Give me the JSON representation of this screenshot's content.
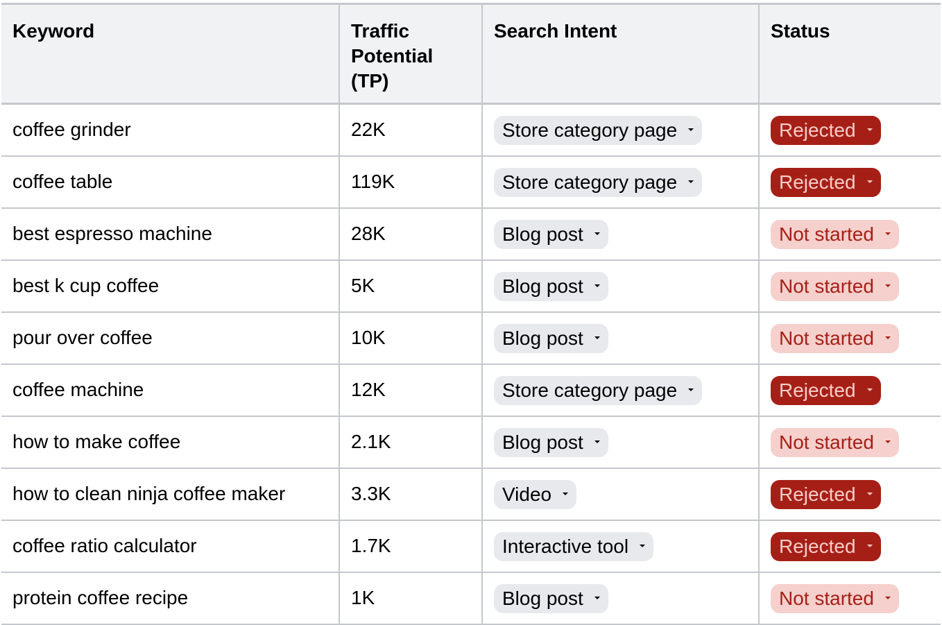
{
  "table": {
    "headers": {
      "keyword": "Keyword",
      "traffic_line1": "Traffic",
      "traffic_line2": "Potential",
      "traffic_line3": "(TP)",
      "intent": "Search Intent",
      "status": "Status"
    },
    "rows": [
      {
        "keyword": "coffee grinder",
        "tp": "22K",
        "intent": "Store category page",
        "status": "Rejected"
      },
      {
        "keyword": "coffee table",
        "tp": "119K",
        "intent": "Store category page",
        "status": "Rejected"
      },
      {
        "keyword": "best espresso machine",
        "tp": "28K",
        "intent": "Blog post",
        "status": "Not started"
      },
      {
        "keyword": "best k cup coffee",
        "tp": "5K",
        "intent": "Blog post",
        "status": "Not started"
      },
      {
        "keyword": "pour over coffee",
        "tp": "10K",
        "intent": "Blog post",
        "status": "Not started"
      },
      {
        "keyword": "coffee machine",
        "tp": "12K",
        "intent": "Store category page",
        "status": "Rejected"
      },
      {
        "keyword": "how to make coffee",
        "tp": "2.1K",
        "intent": "Blog post",
        "status": "Not started"
      },
      {
        "keyword": "how to clean ninja coffee maker",
        "tp": "3.3K",
        "intent": "Video",
        "status": "Rejected"
      },
      {
        "keyword": "coffee ratio calculator",
        "tp": "1.7K",
        "intent": "Interactive tool",
        "status": "Rejected"
      },
      {
        "keyword": "protein coffee recipe",
        "tp": "1K",
        "intent": "Blog post",
        "status": "Not started"
      }
    ]
  },
  "colors": {
    "header_bg": "#f1f2f4",
    "border": "#c4c7cc",
    "intent_chip_bg": "#e8e9ed",
    "rejected_bg": "#a61f17",
    "rejected_text": "#f6cdc8",
    "not_started_bg": "#f5d0cc",
    "not_started_text": "#a61f17"
  },
  "icons": {
    "dropdown": "caret-down-icon"
  }
}
